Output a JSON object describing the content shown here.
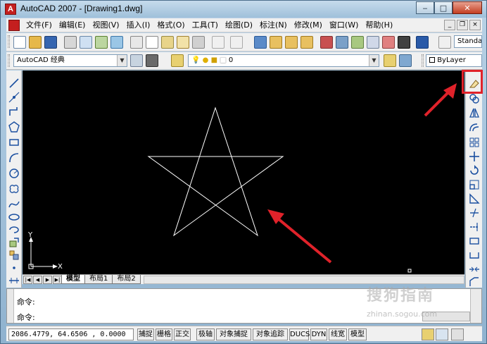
{
  "window": {
    "title": "AutoCAD 2007 - [Drawing1.dwg]",
    "icon_letter": "A",
    "controls": {
      "minimize": "‒",
      "maximize": "□",
      "close": "✕"
    }
  },
  "menu": {
    "items": [
      "文件(F)",
      "编辑(E)",
      "视图(V)",
      "插入(I)",
      "格式(O)",
      "工具(T)",
      "绘图(D)",
      "标注(N)",
      "修改(M)",
      "窗口(W)",
      "帮助(H)"
    ],
    "mdi": {
      "minimize": "_",
      "restore": "❐",
      "close": "×"
    }
  },
  "toolbar": {
    "workspace": "AutoCAD 经典",
    "layer": "0",
    "color": "ByLayer",
    "text_style": "Standa"
  },
  "layout_tabs": [
    "模型",
    "布局1",
    "布局2"
  ],
  "command": {
    "line1": "命令:",
    "line2": "命令:"
  },
  "status": {
    "coords": "2086.4779, 64.6506 , 0.0000",
    "buttons": [
      "捕捉",
      "栅格",
      "正交",
      "极轴",
      "对象捕捉",
      "对象追踪",
      "DUCS",
      "DYN",
      "线宽",
      "模型"
    ]
  },
  "ucs": {
    "x": "X",
    "y": "Y"
  },
  "watermark": {
    "text": "搜狗指南",
    "url": "zhinan.sogou.com"
  },
  "colors": {
    "highlight": "#e0222a",
    "canvas": "#000000",
    "star": "#ffffff"
  }
}
